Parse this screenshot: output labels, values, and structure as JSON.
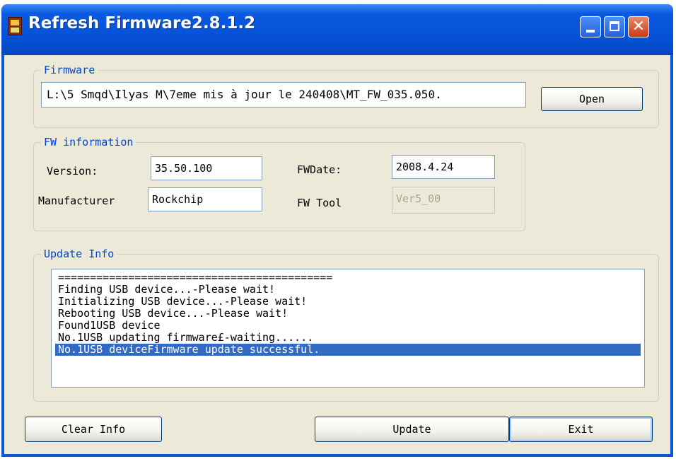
{
  "window": {
    "title": "Refresh Firmware2.8.1.2"
  },
  "firmware": {
    "legend": "Firmware",
    "path": "L:\\5 Smqd\\Ilyas M\\7eme mis à jour le 240408\\MT_FW_035.050.",
    "open_label": "Open"
  },
  "fw_info": {
    "legend": "FW information",
    "version_label": "Version:",
    "version_value": "35.50.100",
    "fwdate_label": "FWDate:",
    "fwdate_value": "2008.4.24",
    "manufacturer_label": "Manufacturer",
    "manufacturer_value": "Rockchip",
    "fwtool_label": "FW Tool",
    "fwtool_value": "Ver5_00"
  },
  "update_info": {
    "legend": "Update Info",
    "lines": [
      "===========================================",
      "Finding USB device...-Please wait!",
      "Initializing USB device...-Please wait!",
      "Rebooting USB device...-Please wait!",
      "Found1USB device",
      "No.1USB updating firmware£-waiting......",
      "No.1USB deviceFirmware update successful."
    ],
    "selected_index": 6
  },
  "buttons": {
    "clear_info": "Clear Info",
    "update": "Update",
    "exit": "Exit"
  },
  "colors": {
    "title_bar": "#0553D9",
    "legend_text": "#0046D5",
    "selection": "#316AC5",
    "dialog_bg": "#ECE9D8"
  },
  "icons": {
    "app": "device-icon",
    "minimize": "minimize-icon",
    "maximize": "maximize-icon",
    "close": "close-icon"
  }
}
